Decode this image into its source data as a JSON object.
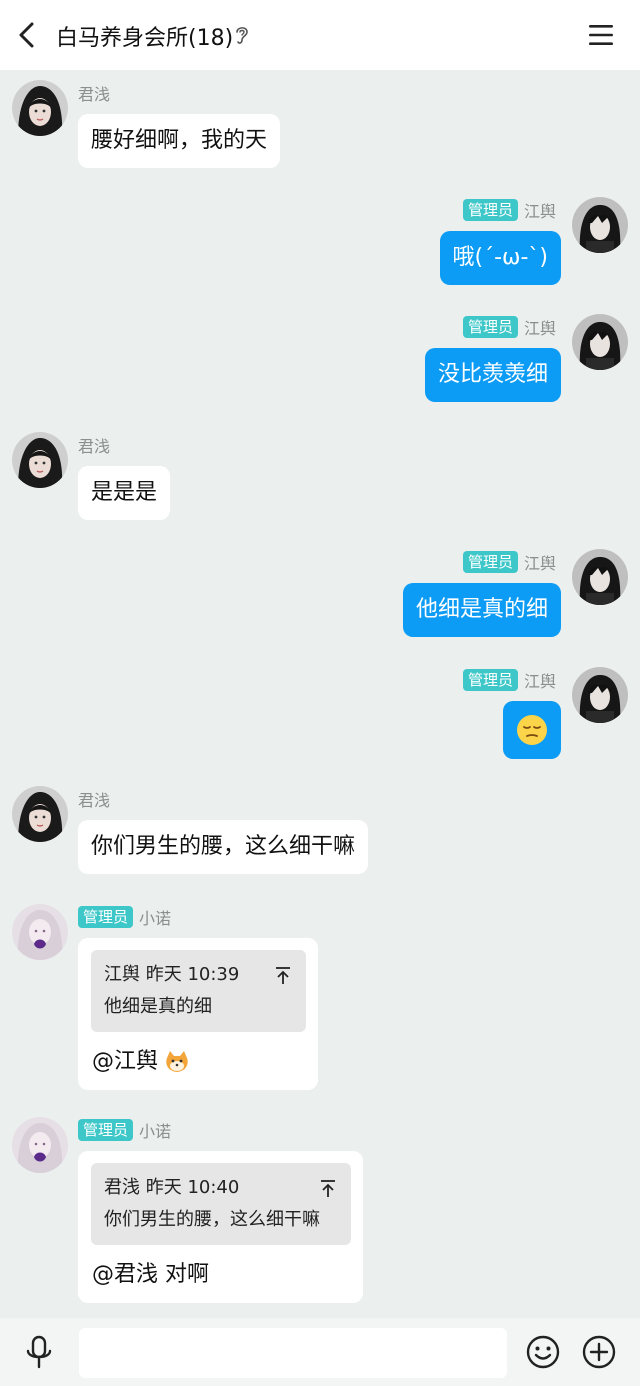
{
  "header": {
    "title": "白马养身会所(18)",
    "back_icon": "chevron-left-icon",
    "ear_icon": "ear-icon",
    "menu_icon": "hamburger-menu-icon"
  },
  "messages": [
    {
      "sender": "君浅",
      "side": "left",
      "text": "腰好细啊，我的天"
    },
    {
      "sender": "江舆",
      "side": "right",
      "badge": "管理员",
      "text": "哦(´-ω-`)"
    },
    {
      "sender": "江舆",
      "side": "right",
      "badge": "管理员",
      "text": "没比羡羡细"
    },
    {
      "sender": "君浅",
      "side": "left",
      "text": "是是是"
    },
    {
      "sender": "江舆",
      "side": "right",
      "badge": "管理员",
      "text": "他细是真的细"
    },
    {
      "sender": "江舆",
      "side": "right",
      "badge": "管理员",
      "emoji": "smirk-face-emoji"
    },
    {
      "sender": "君浅",
      "side": "left",
      "text": "你们男生的腰，这么细干嘛"
    },
    {
      "sender": "小诺",
      "side": "left",
      "badge": "管理员",
      "quote": {
        "author": "江舆",
        "time": "昨天 10:39",
        "text": "他细是真的细"
      },
      "reply": "@江舆",
      "reply_emoji": "shiba-dog-emoji"
    },
    {
      "sender": "小诺",
      "side": "left",
      "badge": "管理员",
      "quote": {
        "author": "君浅",
        "time": "昨天 10:40",
        "text": "你们男生的腰，这么细干嘛"
      },
      "reply": "@君浅 对啊"
    }
  ],
  "bottom_bar": {
    "mic_icon": "microphone-icon",
    "input_value": "",
    "emoji_icon": "smiley-icon",
    "plus_icon": "plus-circle-icon"
  },
  "colors": {
    "background": "#ebf0ee",
    "bubble_self": "#0c9bf5",
    "admin_badge": "#3ec7c9"
  }
}
